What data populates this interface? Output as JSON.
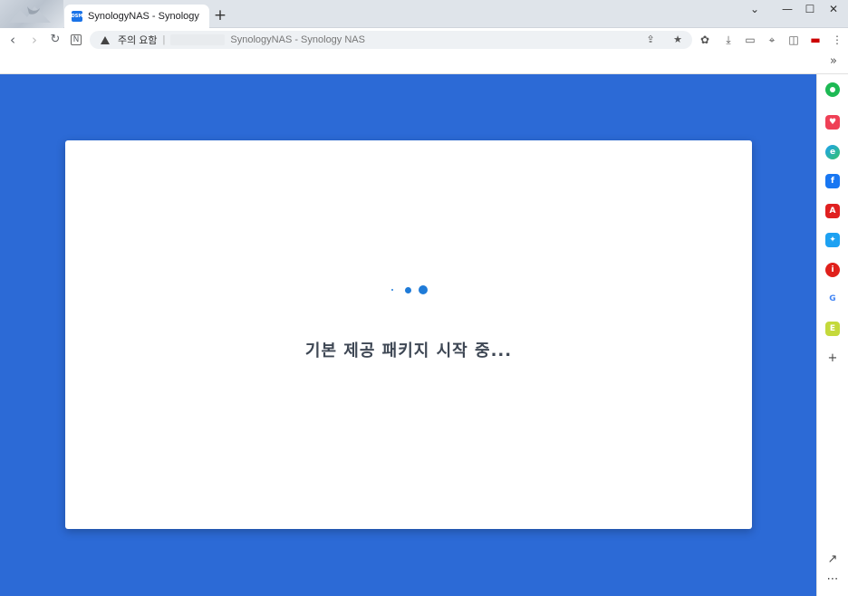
{
  "browser": {
    "tab": {
      "favicon_text": "DSM",
      "title": "SynologyNAS - Synology NAS"
    },
    "new_tab_icon": "plus-icon",
    "window_controls": {
      "dropdown": "⌄",
      "minimize": "—",
      "maximize": "☐",
      "close": "✕"
    },
    "address_bar": {
      "security_label": "주의 요함",
      "separator": "|",
      "url_text": "SynologyNAS - Synology NAS"
    },
    "sidebar_toggle": "»"
  },
  "dialog": {
    "loading_text": "기본 제공 패키지 시작 중..."
  },
  "sidebar": {
    "items": [
      {
        "name": "green-circle-app-icon",
        "color": "#1db954",
        "label": ""
      },
      {
        "name": "pocket-icon",
        "color": "#ef4056",
        "label": ""
      },
      {
        "name": "edge-icon",
        "color": "#1da1f2",
        "label": ""
      },
      {
        "name": "facebook-icon",
        "color": "#1877f2",
        "label": "f"
      },
      {
        "name": "adobe-acrobat-icon",
        "color": "#e02020",
        "label": "A"
      },
      {
        "name": "twitter-icon",
        "color": "#1da1f2",
        "label": ""
      },
      {
        "name": "info-app-icon",
        "color": "#e0201b",
        "label": "i"
      },
      {
        "name": "google-icon",
        "color": "#ffffff",
        "label": "G"
      },
      {
        "name": "evernote-icon",
        "color": "#c4d93b",
        "label": "E"
      }
    ],
    "add_label": "+",
    "external_label": "↗",
    "more_label": "⋯"
  },
  "colors": {
    "content_background": "#2c6ad6",
    "spinner": "#1f7bd8",
    "text": "#3e4754"
  }
}
